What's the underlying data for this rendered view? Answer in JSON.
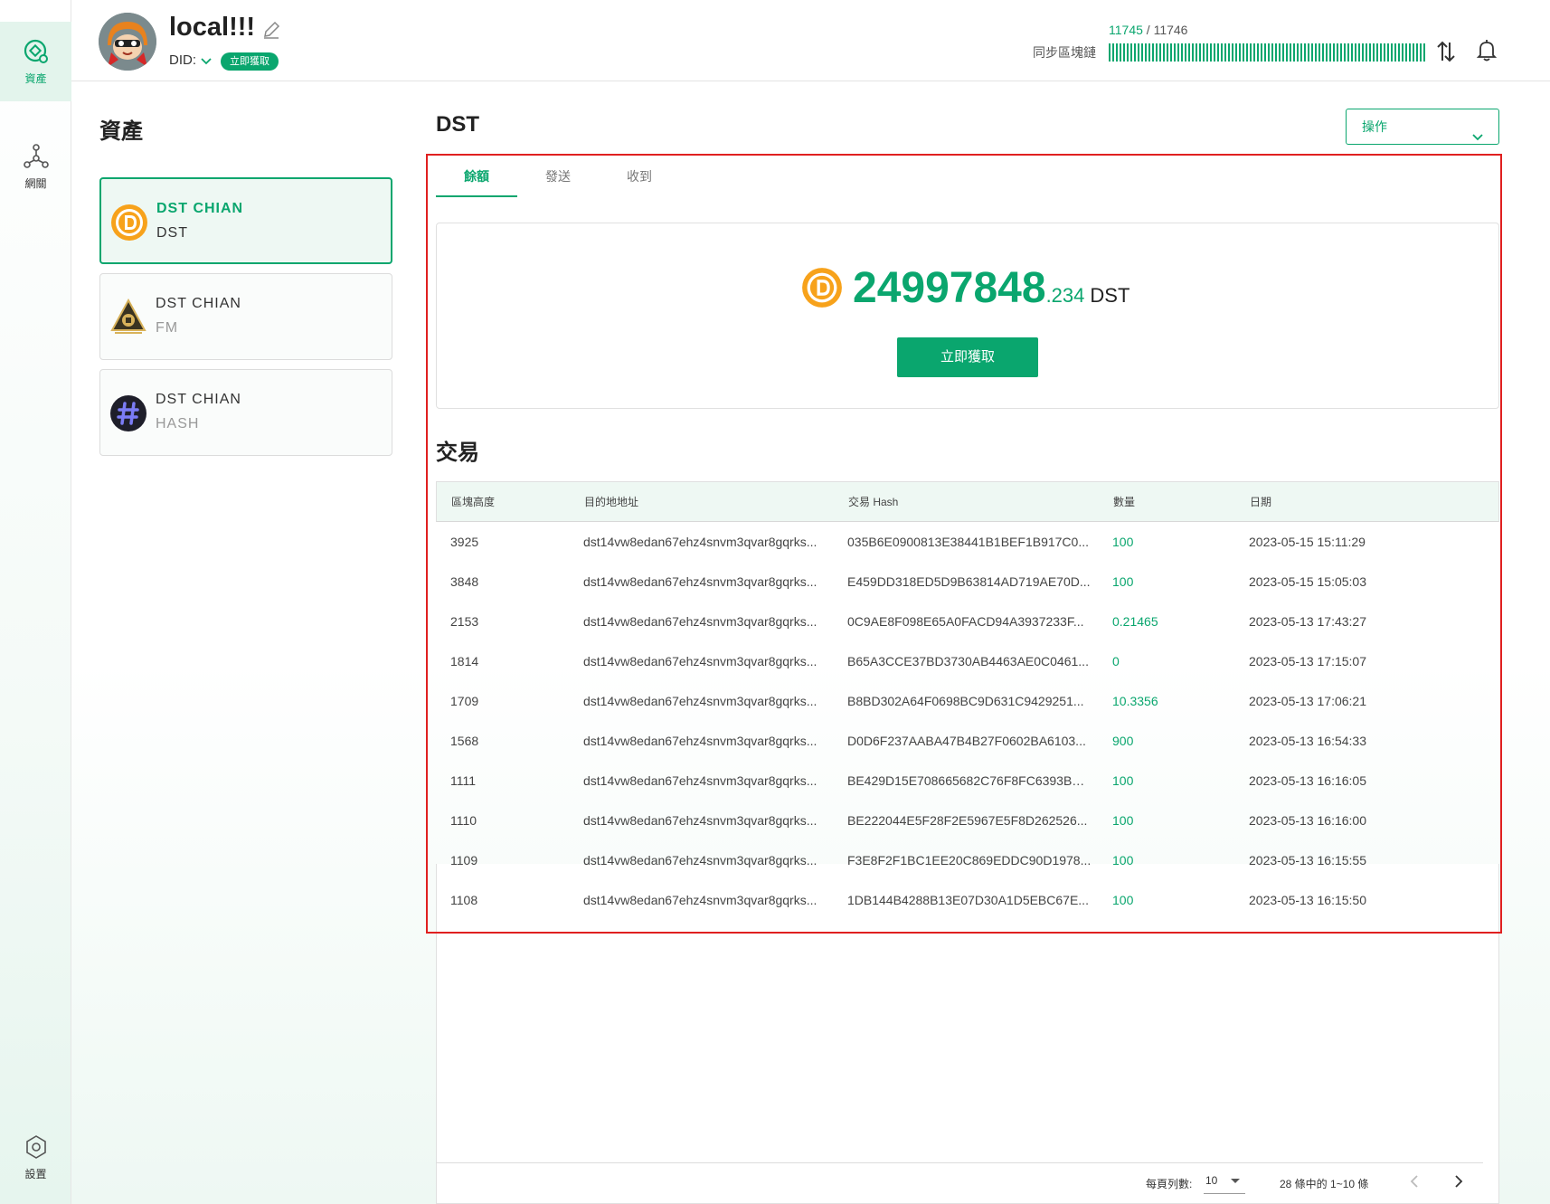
{
  "nav": {
    "items": [
      {
        "label": "資產",
        "icon": "assets-icon",
        "active": true
      },
      {
        "label": "網關",
        "icon": "network-icon",
        "active": false
      },
      {
        "label": "設置",
        "icon": "settings-icon",
        "active": false
      }
    ]
  },
  "header": {
    "profile_name": "local!!!",
    "did_label": "DID:",
    "did_badge": "立即獲取",
    "sync_current": "11745",
    "sync_sep": " / ",
    "sync_total": "11746",
    "sync_label": "同步區塊鏈",
    "sync_progress": 0.9999
  },
  "assets": {
    "title": "資產",
    "items": [
      {
        "name": "DST CHIAN",
        "symbol": "DST",
        "icon": "dst-coin-icon",
        "active": true
      },
      {
        "name": "DST CHIAN",
        "symbol": "FM",
        "icon": "fm-coin-icon",
        "active": false
      },
      {
        "name": "DST CHIAN",
        "symbol": "HASH",
        "icon": "hash-coin-icon",
        "active": false
      }
    ]
  },
  "main": {
    "title": "DST",
    "ops_label": "操作",
    "tabs": [
      "餘額",
      "發送",
      "收到"
    ],
    "balance": {
      "integer": "24997848",
      "decimal": ".234",
      "unit": "DST",
      "claim_label": "立即獲取"
    },
    "tx_title": "交易",
    "tx_headers": [
      "區塊高度",
      "目的地地址",
      "交易 Hash",
      "數量",
      "日期"
    ],
    "tx_rows": [
      {
        "height": "3925",
        "address": "dst14vw8edan67ehz4snvm3qvar8gqrks...",
        "hash": "035B6E0900813E38441B1BEF1B917C0...",
        "amount": "100",
        "date": "2023-05-15 15:11:29"
      },
      {
        "height": "3848",
        "address": "dst14vw8edan67ehz4snvm3qvar8gqrks...",
        "hash": "E459DD318ED5D9B63814AD719AE70D...",
        "amount": "100",
        "date": "2023-05-15 15:05:03"
      },
      {
        "height": "2153",
        "address": "dst14vw8edan67ehz4snvm3qvar8gqrks...",
        "hash": "0C9AE8F098E65A0FACD94A3937233F...",
        "amount": "0.21465",
        "date": "2023-05-13 17:43:27"
      },
      {
        "height": "1814",
        "address": "dst14vw8edan67ehz4snvm3qvar8gqrks...",
        "hash": "B65A3CCE37BD3730AB4463AE0C0461...",
        "amount": "0",
        "date": "2023-05-13 17:15:07"
      },
      {
        "height": "1709",
        "address": "dst14vw8edan67ehz4snvm3qvar8gqrks...",
        "hash": "B8BD302A64F0698BC9D631C9429251...",
        "amount": "10.3356",
        "date": "2023-05-13 17:06:21"
      },
      {
        "height": "1568",
        "address": "dst14vw8edan67ehz4snvm3qvar8gqrks...",
        "hash": "D0D6F237AABA47B4B27F0602BA6103...",
        "amount": "900",
        "date": "2023-05-13 16:54:33"
      },
      {
        "height": "1111",
        "address": "dst14vw8edan67ehz4snvm3qvar8gqrks...",
        "hash": "BE429D15E708665682C76F8FC6393BD...",
        "amount": "100",
        "date": "2023-05-13 16:16:05"
      },
      {
        "height": "1110",
        "address": "dst14vw8edan67ehz4snvm3qvar8gqrks...",
        "hash": "BE222044E5F28F2E5967E5F8D262526...",
        "amount": "100",
        "date": "2023-05-13 16:16:00"
      },
      {
        "height": "1109",
        "address": "dst14vw8edan67ehz4snvm3qvar8gqrks...",
        "hash": "F3E8F2F1BC1EE20C869EDDC90D1978...",
        "amount": "100",
        "date": "2023-05-13 16:15:55"
      },
      {
        "height": "1108",
        "address": "dst14vw8edan67ehz4snvm3qvar8gqrks...",
        "hash": "1DB144B4288B13E07D30A1D5EBC67E...",
        "amount": "100",
        "date": "2023-05-13 16:15:50"
      }
    ],
    "pager": {
      "rows_label": "每頁列數:",
      "rows_value": "10",
      "range_label": "28 條中的 1~10 條"
    }
  },
  "colors": {
    "accent": "#0aa66e",
    "highlight_frame": "#e02020"
  }
}
